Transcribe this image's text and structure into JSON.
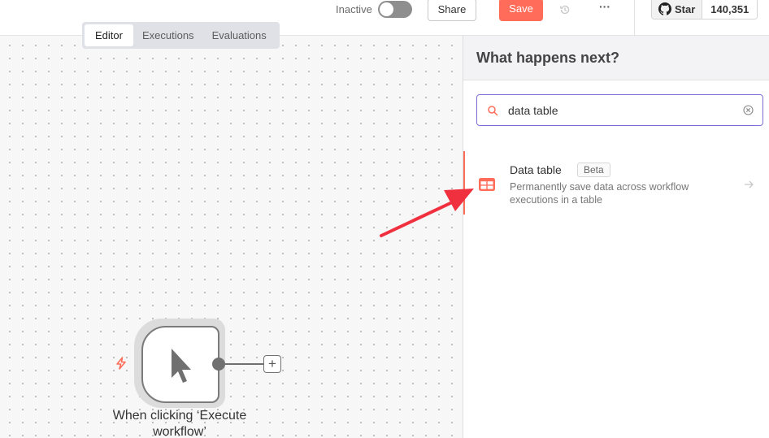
{
  "header": {
    "active_toggle_label": "Inactive",
    "active_toggle_on": false,
    "share_label": "Share",
    "save_label": "Save",
    "history_icon": "history-icon",
    "more_label": "···",
    "github": {
      "icon": "github-icon",
      "star_label": "Star",
      "star_count": "140,351"
    }
  },
  "tabs": [
    {
      "label": "Editor",
      "active": true
    },
    {
      "label": "Executions",
      "active": false
    },
    {
      "label": "Evaluations",
      "active": false
    }
  ],
  "node_panel": {
    "title": "What happens next?",
    "search": {
      "value": "data table",
      "icon": "search-icon",
      "clear_icon": "clear-icon"
    },
    "results": [
      {
        "icon": "table-icon",
        "title": "Data table",
        "badge": "Beta",
        "description": "Permanently save data across workflow executions in a table"
      }
    ]
  },
  "canvas": {
    "trigger_node": {
      "label": "When clicking ‘Execute workflow’",
      "icon": "cursor-icon",
      "trigger_icon": "lightning-icon",
      "add_icon": "+"
    }
  },
  "colors": {
    "accent": "#ff6d5a",
    "search_border": "#7b6fd6",
    "annotation": "#f0303f"
  }
}
